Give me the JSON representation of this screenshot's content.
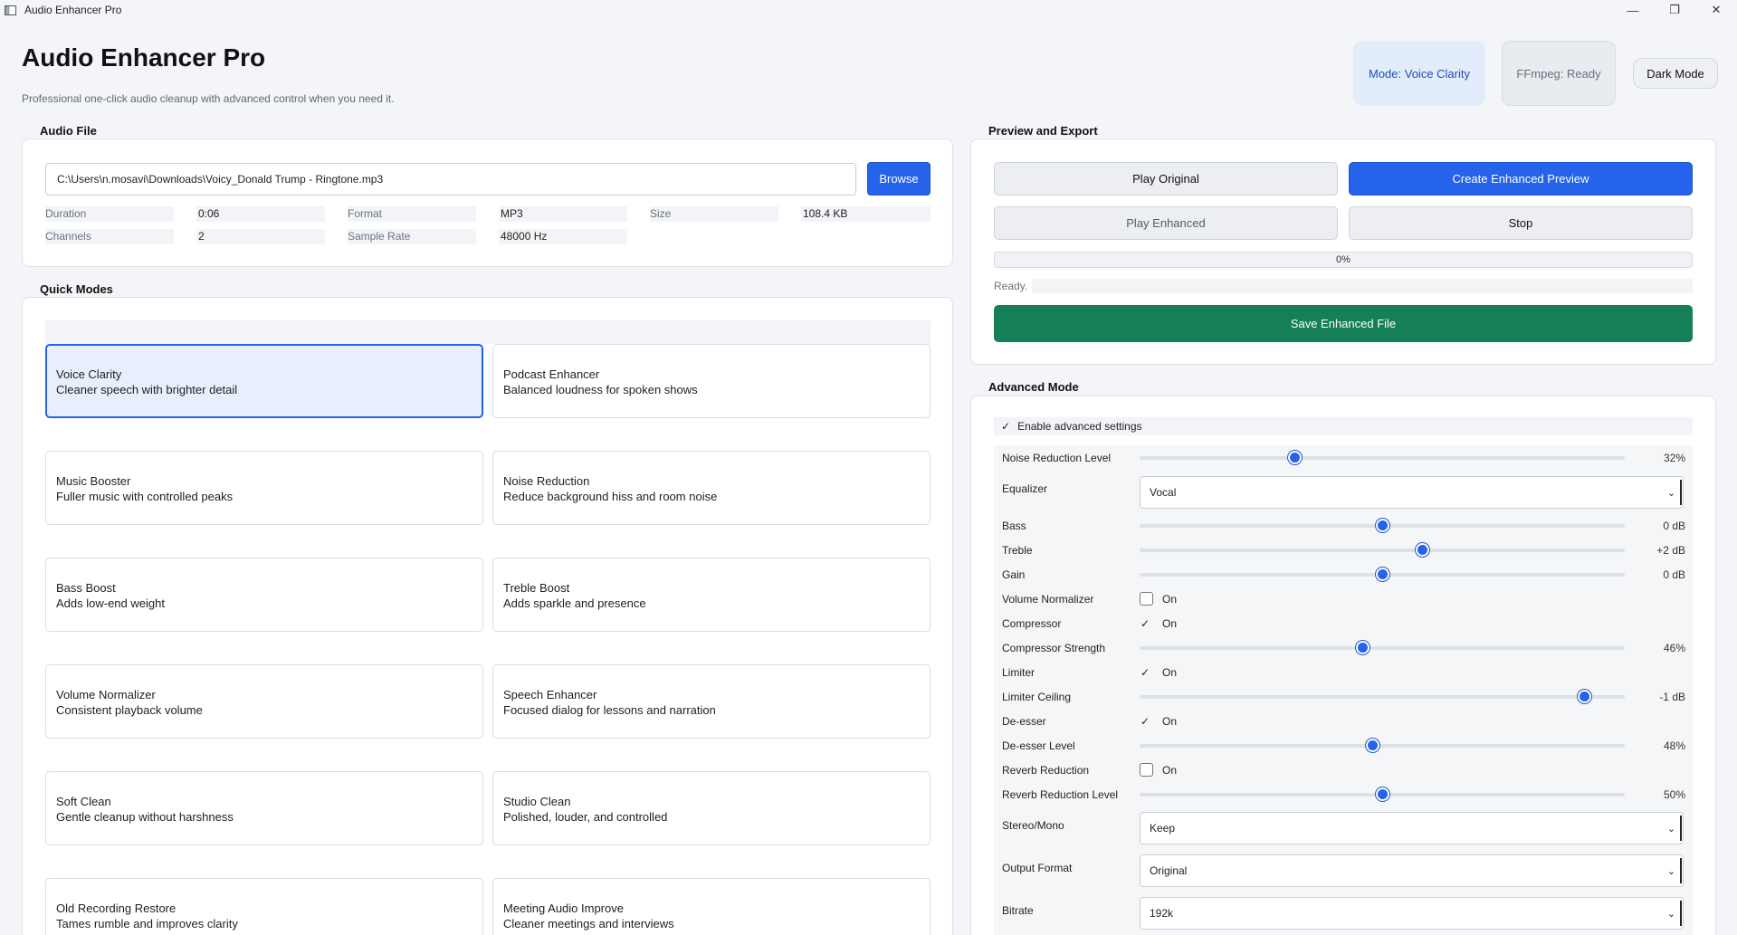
{
  "window": {
    "title": "Audio Enhancer Pro",
    "controls": {
      "minimize": "—",
      "maximize": "❐",
      "close": "✕"
    }
  },
  "header": {
    "title": "Audio Enhancer Pro",
    "subtitle": "Professional one-click audio cleanup with advanced control when you need it.",
    "mode_chip": "Mode: Voice Clarity",
    "ffmpeg_chip": "FFmpeg: Ready",
    "dark_mode_button": "Dark Mode"
  },
  "audio_file": {
    "section_title": "Audio File",
    "path": "C:\\Users\\n.mosavi\\Downloads\\Voicy_Donald Trump - Ringtone.mp3",
    "browse_button": "Browse",
    "meta": {
      "duration_label": "Duration",
      "duration_value": "0:06",
      "format_label": "Format",
      "format_value": "MP3",
      "size_label": "Size",
      "size_value": "108.4 KB",
      "channels_label": "Channels",
      "channels_value": "2",
      "sample_rate_label": "Sample Rate",
      "sample_rate_value": "48000 Hz"
    }
  },
  "quick_modes": {
    "section_title": "Quick Modes",
    "selected": "Voice Clarity",
    "modes": [
      {
        "name": "Voice Clarity",
        "desc": "Cleaner speech with brighter detail"
      },
      {
        "name": "Podcast Enhancer",
        "desc": "Balanced loudness for spoken shows"
      },
      {
        "name": "Music Booster",
        "desc": "Fuller music with controlled peaks"
      },
      {
        "name": "Noise Reduction",
        "desc": "Reduce background hiss and room noise"
      },
      {
        "name": "Bass Boost",
        "desc": "Adds low-end weight"
      },
      {
        "name": "Treble Boost",
        "desc": "Adds sparkle and presence"
      },
      {
        "name": "Volume Normalizer",
        "desc": "Consistent playback volume"
      },
      {
        "name": "Speech Enhancer",
        "desc": "Focused dialog for lessons and narration"
      },
      {
        "name": "Soft Clean",
        "desc": "Gentle cleanup without harshness"
      },
      {
        "name": "Studio Clean",
        "desc": "Polished, louder, and controlled"
      },
      {
        "name": "Old Recording Restore",
        "desc": "Tames rumble and improves clarity"
      },
      {
        "name": "Meeting Audio Improve",
        "desc": "Cleaner meetings and interviews"
      }
    ]
  },
  "preview": {
    "section_title": "Preview and Export",
    "play_original": "Play Original",
    "create_preview": "Create Enhanced Preview",
    "play_enhanced": "Play Enhanced",
    "stop": "Stop",
    "progress_text": "0%",
    "progress": 0,
    "status": "Ready.",
    "save_button": "Save Enhanced File"
  },
  "advanced": {
    "section_title": "Advanced Mode",
    "enable_label": "Enable advanced settings",
    "enabled": true,
    "check_glyph": "✓",
    "on_label": "On",
    "noise_reduction": {
      "label": "Noise Reduction Level",
      "value": 32,
      "display": "32%"
    },
    "equalizer": {
      "label": "Equalizer",
      "value": "Vocal"
    },
    "bass": {
      "label": "Bass",
      "value": 0,
      "display": "0 dB"
    },
    "treble": {
      "label": "Treble",
      "value": 2,
      "display": "+2 dB"
    },
    "gain": {
      "label": "Gain",
      "value": 0,
      "display": "0 dB"
    },
    "volume_normalizer": {
      "label": "Volume Normalizer",
      "checked": false
    },
    "compressor": {
      "label": "Compressor",
      "checked": true
    },
    "compressor_strength": {
      "label": "Compressor Strength",
      "value": 46,
      "display": "46%"
    },
    "limiter": {
      "label": "Limiter",
      "checked": true
    },
    "limiter_ceiling": {
      "label": "Limiter Ceiling",
      "value": -1,
      "display": "-1 dB"
    },
    "deesser": {
      "label": "De-esser",
      "checked": true
    },
    "deesser_level": {
      "label": "De-esser Level",
      "value": 48,
      "display": "48%"
    },
    "reverb_reduction": {
      "label": "Reverb Reduction",
      "checked": false
    },
    "reverb_reduction_level": {
      "label": "Reverb Reduction Level",
      "value": 50,
      "display": "50%"
    },
    "stereo_mono": {
      "label": "Stereo/Mono",
      "value": "Keep"
    },
    "output_format": {
      "label": "Output Format",
      "value": "Original"
    },
    "bitrate": {
      "label": "Bitrate",
      "value": "192k"
    },
    "caret_glyph": "⌄"
  },
  "colors": {
    "accent": "#2563eb",
    "save": "#157f57",
    "selected_card_bg": "#e8effc"
  }
}
